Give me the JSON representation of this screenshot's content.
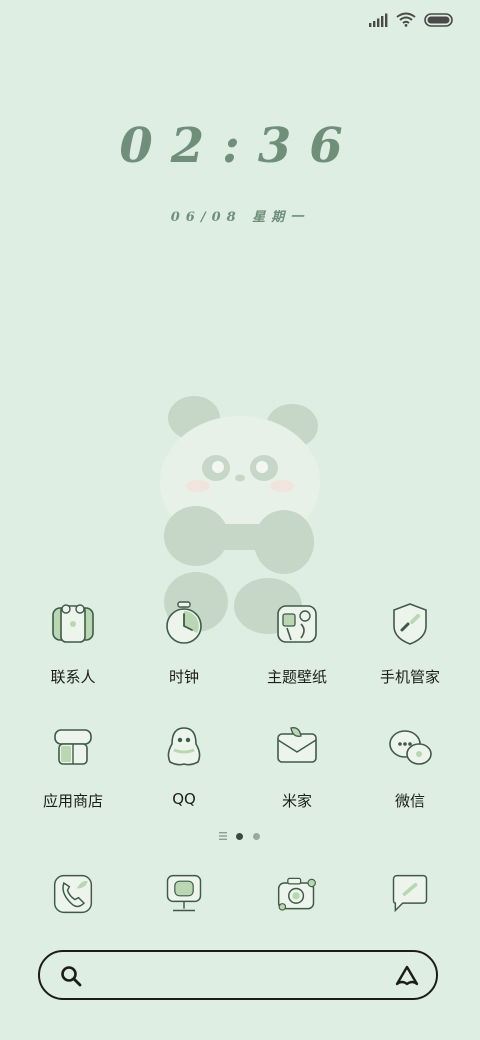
{
  "status_bar": {
    "icons": [
      "signal-icon",
      "wifi-icon",
      "battery-icon"
    ]
  },
  "lockscreen": {
    "time": "02:36",
    "date": "06/08 星期一"
  },
  "pages": {
    "count": 3,
    "current": 2
  },
  "apps_row1": [
    {
      "label": "联系人",
      "icon": "contacts-icon"
    },
    {
      "label": "时钟",
      "icon": "clock-icon"
    },
    {
      "label": "主题壁纸",
      "icon": "themes-icon"
    },
    {
      "label": "手机管家",
      "icon": "security-icon"
    }
  ],
  "apps_row2": [
    {
      "label": "应用商店",
      "icon": "app-store-icon"
    },
    {
      "label": "QQ",
      "icon": "qq-icon"
    },
    {
      "label": "米家",
      "icon": "mihome-icon"
    },
    {
      "label": "微信",
      "icon": "wechat-icon"
    }
  ],
  "dock": [
    {
      "icon": "phone-icon"
    },
    {
      "icon": "browser-icon"
    },
    {
      "icon": "camera-icon"
    },
    {
      "icon": "messages-icon"
    }
  ],
  "search_bar": {
    "left_icon": "search-icon",
    "right_icon": "assistant-icon"
  },
  "colors": {
    "background": "#dfeee2",
    "accent": "#6f8f7a",
    "icon_fill": "#b8d7b2",
    "stroke": "#3f5b48"
  }
}
